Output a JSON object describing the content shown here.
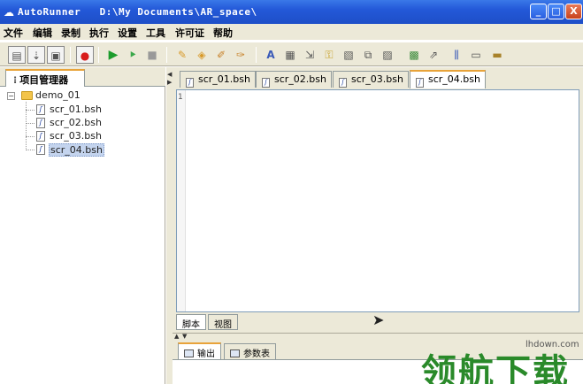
{
  "window": {
    "title": "AutoRunner   D:\\My Documents\\AR_space\\",
    "minimize_label": "_",
    "maximize_label": "□",
    "close_label": "X"
  },
  "menu": [
    "文件",
    "编辑",
    "录制",
    "执行",
    "设置",
    "工具",
    "许可证",
    "帮助"
  ],
  "toolbar": {
    "icons": [
      "new-script-icon",
      "open-icon",
      "save-icon",
      "record-icon",
      "run-icon",
      "step-icon",
      "stop-icon",
      "checkpoint-icon",
      "tag-icon",
      "pencil-icon",
      "edit-icon",
      "text-size-icon",
      "capture-icon",
      "move-icon",
      "key-icon",
      "object-icon",
      "copy-icon",
      "paste-icon",
      "compare-icon",
      "wizard-icon",
      "align-icon",
      "window-icon",
      "properties-icon"
    ]
  },
  "project_panel": {
    "tab_label": "项目管理器",
    "root": "demo_01",
    "files": [
      "scr_01.bsh",
      "scr_02.bsh",
      "scr_03.bsh",
      "scr_04.bsh"
    ],
    "selected_index": 3
  },
  "editor": {
    "tabs": [
      "scr_01.bsh",
      "scr_02.bsh",
      "scr_03.bsh",
      "scr_04.bsh"
    ],
    "active_tab_index": 3,
    "line_number": "1",
    "view_tabs": [
      "脚本",
      "视图"
    ]
  },
  "output": {
    "tabs": [
      "输出",
      "参数表"
    ]
  },
  "watermark": {
    "text": "领航下载",
    "site": "lhdown.com"
  }
}
